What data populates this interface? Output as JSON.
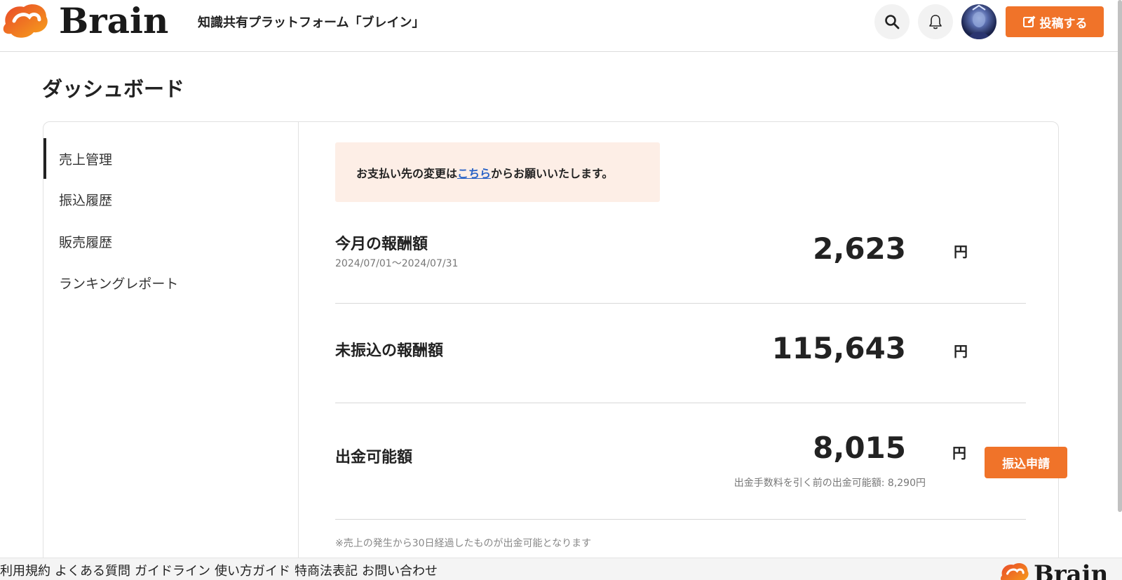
{
  "header": {
    "logo_text": "Brain",
    "tagline": "知識共有プラットフォーム「ブレイン」",
    "post_button_label": "投稿する",
    "accent_color": "#f07329"
  },
  "page": {
    "title": "ダッシュボード"
  },
  "sidebar": {
    "items": [
      {
        "label": "売上管理",
        "active": true
      },
      {
        "label": "振込履歴",
        "active": false
      },
      {
        "label": "販売履歴",
        "active": false
      },
      {
        "label": "ランキングレポート",
        "active": false
      }
    ]
  },
  "notice": {
    "prefix": "お支払い先の変更は",
    "link_text": "こちら",
    "suffix": "からお願いいたします。"
  },
  "earnings": {
    "monthly": {
      "label": "今月の報酬額",
      "period": "2024/07/01～2024/07/31",
      "amount": "2,623",
      "unit": "円"
    },
    "untransferred": {
      "label": "未振込の報酬額",
      "amount": "115,643",
      "unit": "円"
    },
    "withdrawable": {
      "label": "出金可能額",
      "amount": "8,015",
      "unit": "円",
      "fee_note": "出金手数料を引く前の出金可能額: 8,290円",
      "button_label": "振込申請"
    },
    "notes": [
      "※売上の発生から30日経過したものが出金可能となります"
    ]
  },
  "footer": {
    "links": [
      "利用規約",
      "よくある質問",
      "ガイドライン",
      "使い方ガイド",
      "特商法表記",
      "お問い合わせ"
    ],
    "logo_text": "Brain"
  },
  "icons": {
    "search": "search-icon",
    "bell": "bell-icon",
    "pencil": "pencil-icon"
  }
}
